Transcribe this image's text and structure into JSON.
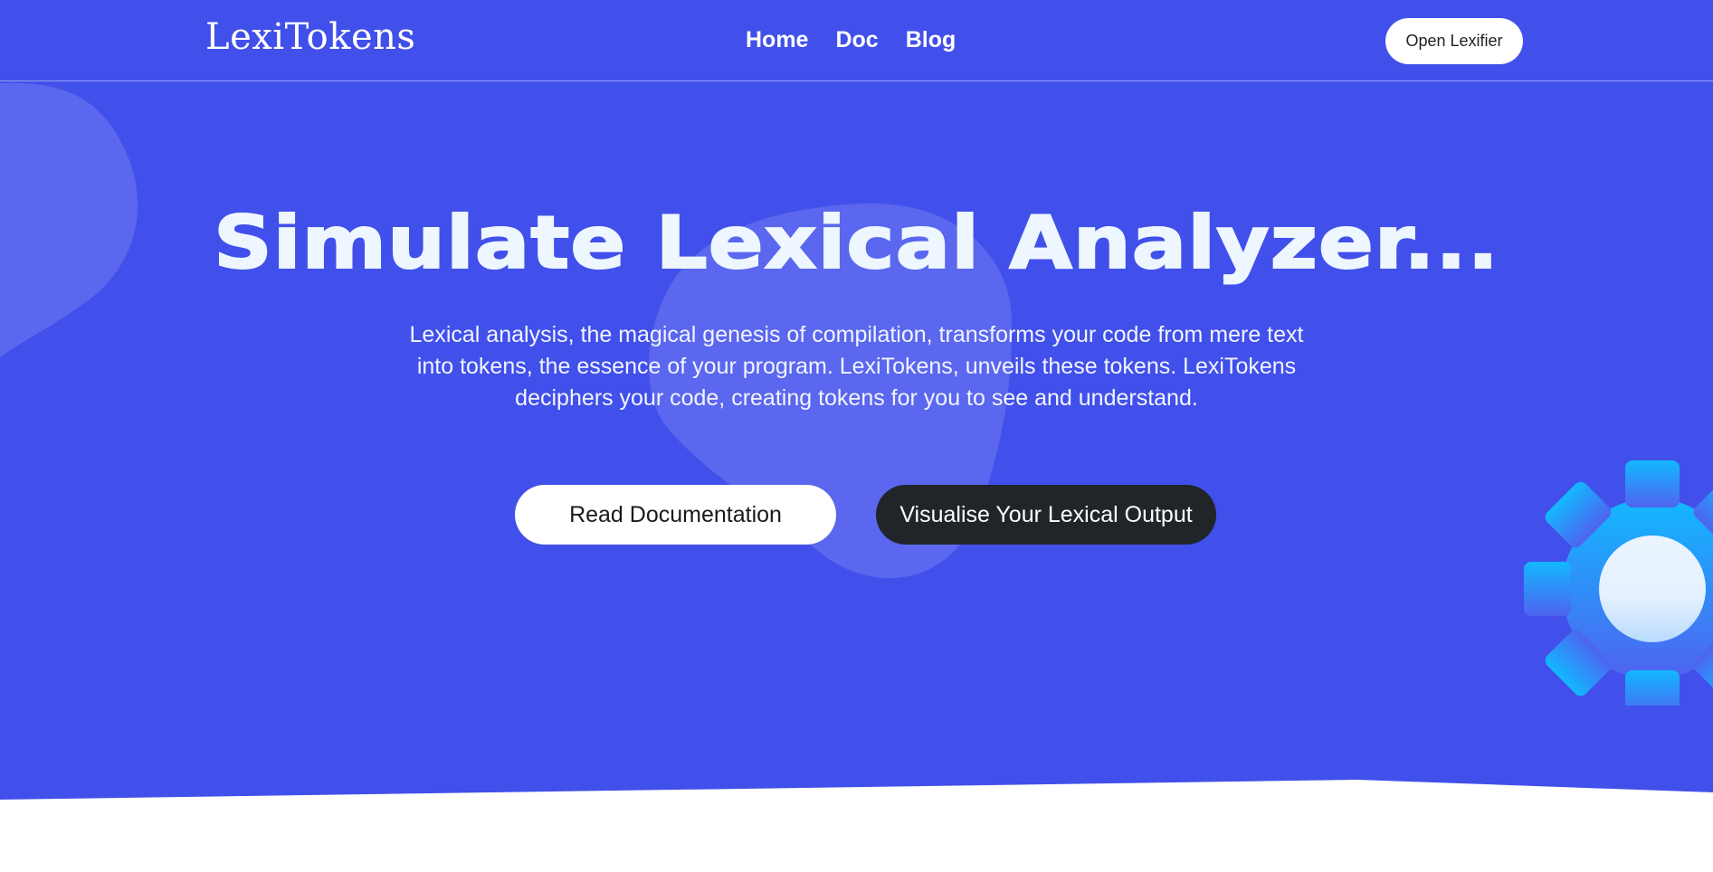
{
  "header": {
    "brand": "LexiTokens",
    "nav": [
      "Home",
      "Doc",
      "Blog"
    ],
    "cta_label": "Open Lexifier"
  },
  "hero": {
    "title": "Simulate Lexical Analyzer...",
    "description": "Lexical analysis, the magical genesis of compilation, transforms your code from mere text into tokens, the essence of your program. LexiTokens, unveils these tokens. LexiTokens deciphers your code, creating tokens for you to see and understand.",
    "primary_button": "Read Documentation",
    "secondary_button": "Visualise Your Lexical Output"
  },
  "theme": {
    "background": "#4150ea",
    "blob": "#5e6cf0",
    "dark_button": "#212529",
    "gear_top": "#1ab4ff",
    "gear_bottom": "#4f63f0"
  },
  "icons": {
    "decoration": "gear-icon"
  }
}
